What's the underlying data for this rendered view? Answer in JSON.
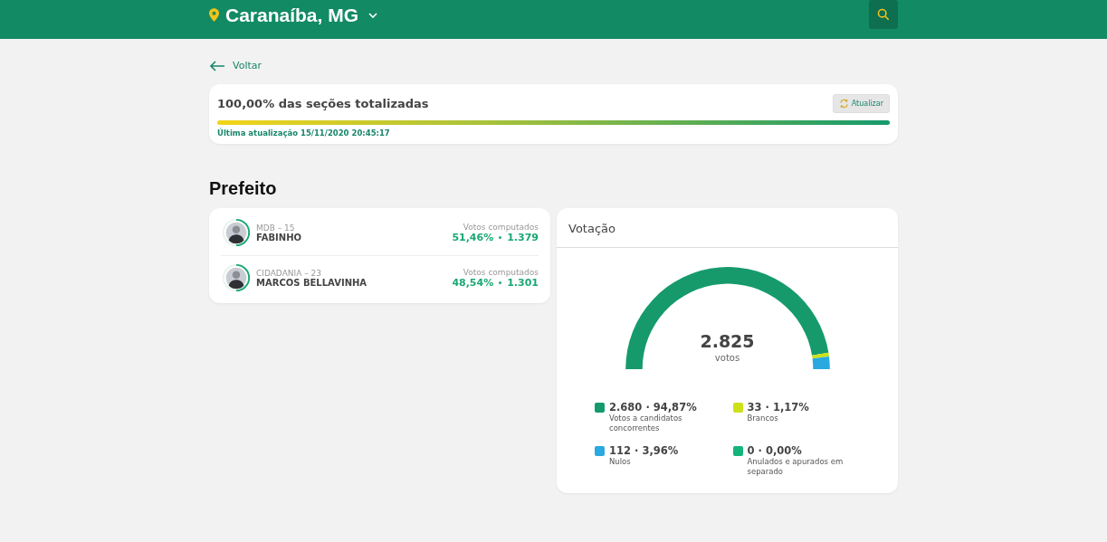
{
  "header": {
    "location": "Caranaíba, MG"
  },
  "back_link": "Voltar",
  "progress": {
    "title": "100,00% das seções totalizadas",
    "level": 1,
    "refresh_button": "Atualizar",
    "updated": "Última atualização 15/11/2020 20:45:17"
  },
  "section_title": "Prefeito",
  "candidates": [
    {
      "party": "MDB – 15",
      "name": "FABINHO",
      "votes_label": "Votos computados",
      "percent": "51,46%",
      "votes": "1.379"
    },
    {
      "party": "CIDADANIA – 23",
      "name": "MARCOS BELLAVINHA",
      "votes_label": "Votos computados",
      "percent": "48,54%",
      "votes": "1.301"
    }
  ],
  "voting": {
    "title": "Votação",
    "total": "2.825",
    "total_label": "votos",
    "chart_data": {
      "type": "donut",
      "values": [
        94.87,
        1.17,
        3.96,
        0
      ]
    },
    "legend": [
      {
        "value": "2.680 · 94,87%",
        "label": "Votos a candidatos concorrentes",
        "color": "#169a6c"
      },
      {
        "value": "33 · 1,17%",
        "label": "Brancos",
        "color": "#cde01a"
      },
      {
        "value": "112 · 3,96%",
        "label": "Nulos",
        "color": "#29a9e0"
      },
      {
        "value": "0 · 0,00%",
        "label": "Anulados e apurados em separado",
        "color": "#13b57a"
      }
    ]
  }
}
